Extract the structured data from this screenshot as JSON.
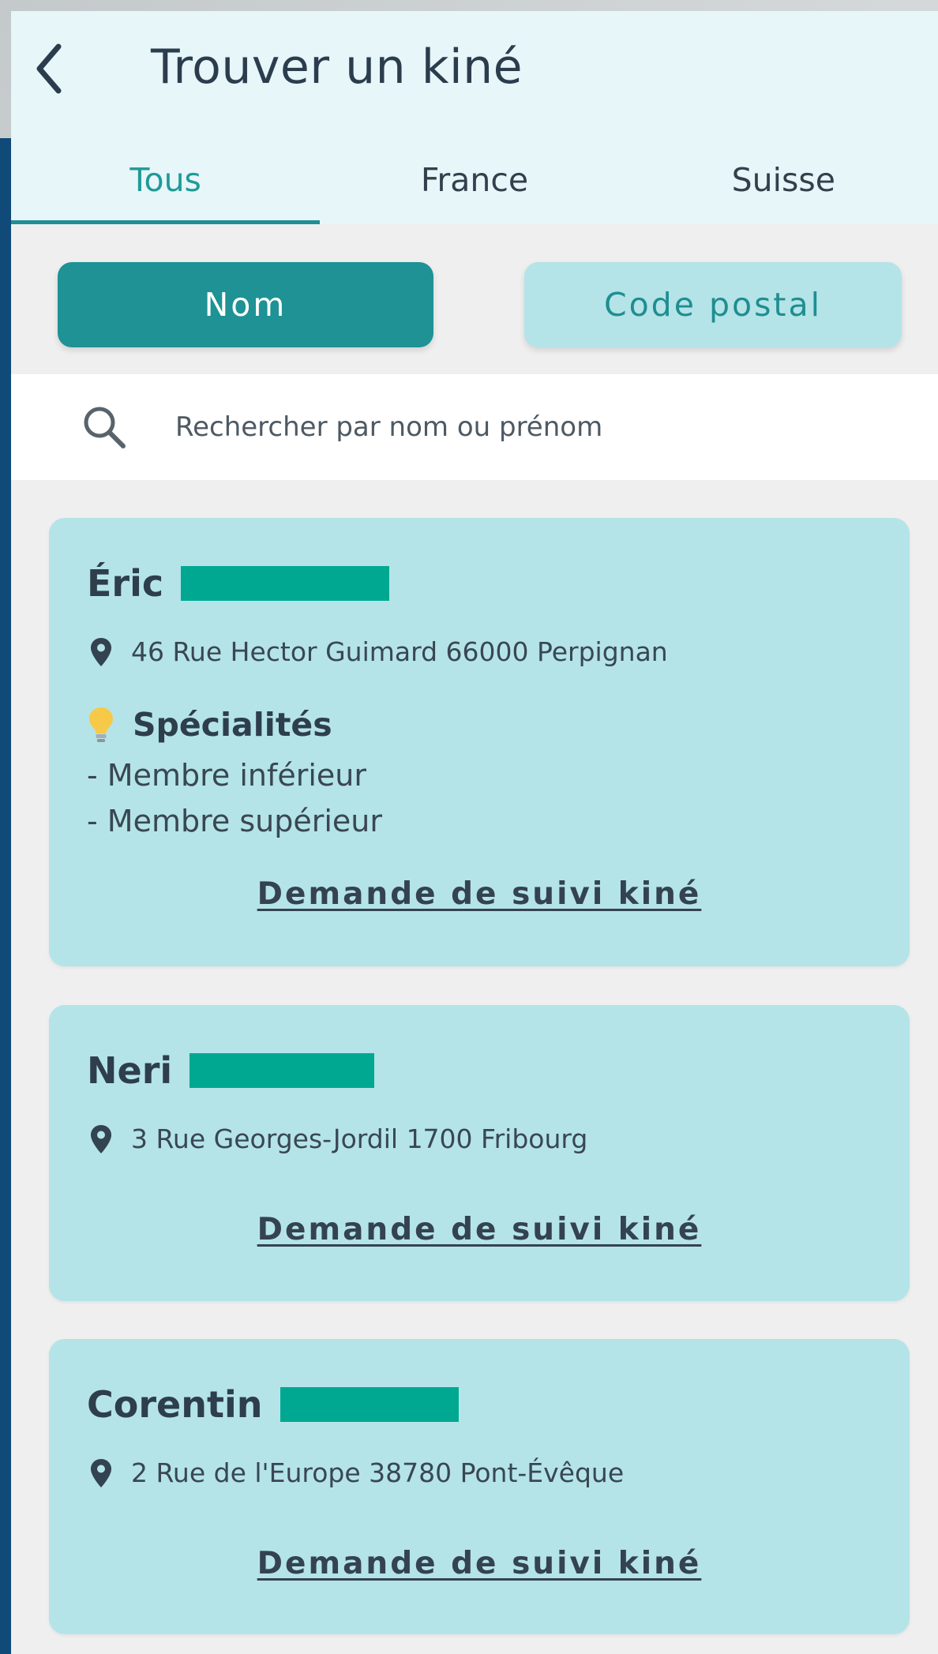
{
  "header": {
    "title": "Trouver un kiné",
    "tabs": [
      {
        "label": "Tous",
        "active": true
      },
      {
        "label": "France",
        "active": false
      },
      {
        "label": "Suisse",
        "active": false
      }
    ]
  },
  "search_mode": {
    "nom_label": "Nom",
    "code_postal_label": "Code postal",
    "selected": "Nom"
  },
  "search": {
    "placeholder": "Rechercher par nom ou prénom",
    "value": ""
  },
  "results": [
    {
      "first_name": "Éric",
      "address": "46 Rue Hector Guimard 66000 Perpignan",
      "specialties_title": "Spécialités",
      "specialties": [
        "- Membre inférieur",
        "- Membre supérieur"
      ],
      "action_label": "Demande de suivi kiné"
    },
    {
      "first_name": "Neri",
      "address": "3 Rue Georges-Jordil 1700 Fribourg",
      "action_label": "Demande de suivi kiné"
    },
    {
      "first_name": "Corentin",
      "address": "2 Rue de l'Europe 38780 Pont-Évêque",
      "action_label": "Demande de suivi kiné"
    }
  ],
  "colors": {
    "accent": "#1e9294",
    "card_bg": "#b4e4e8",
    "header_bg": "#e6f6f9",
    "redaction": "#00a892"
  },
  "icons": {
    "back": "chevron-left-icon",
    "search": "search-icon",
    "location": "map-pin-icon",
    "specialties": "lightbulb-icon"
  }
}
